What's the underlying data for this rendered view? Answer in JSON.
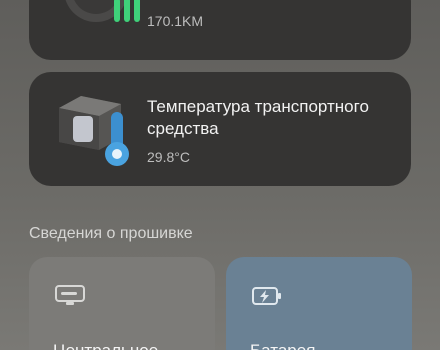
{
  "mileage_card": {
    "value": "170.1KM"
  },
  "temperature_card": {
    "title": "Температура транспортного средства",
    "value": "29.8°C"
  },
  "firmware_section": {
    "title": "Сведения о прошивке",
    "tiles": [
      {
        "label": "Центральное",
        "icon": "monitor-icon"
      },
      {
        "label": "Батарея",
        "icon": "battery-charging-icon"
      }
    ]
  },
  "colors": {
    "card_bg": "#353433",
    "battery_tile_bg": "#6a8194",
    "central_tile_bg": "#7c7b78",
    "accent_green": "#3fd17a",
    "accent_blue": "#4aa3e0"
  }
}
